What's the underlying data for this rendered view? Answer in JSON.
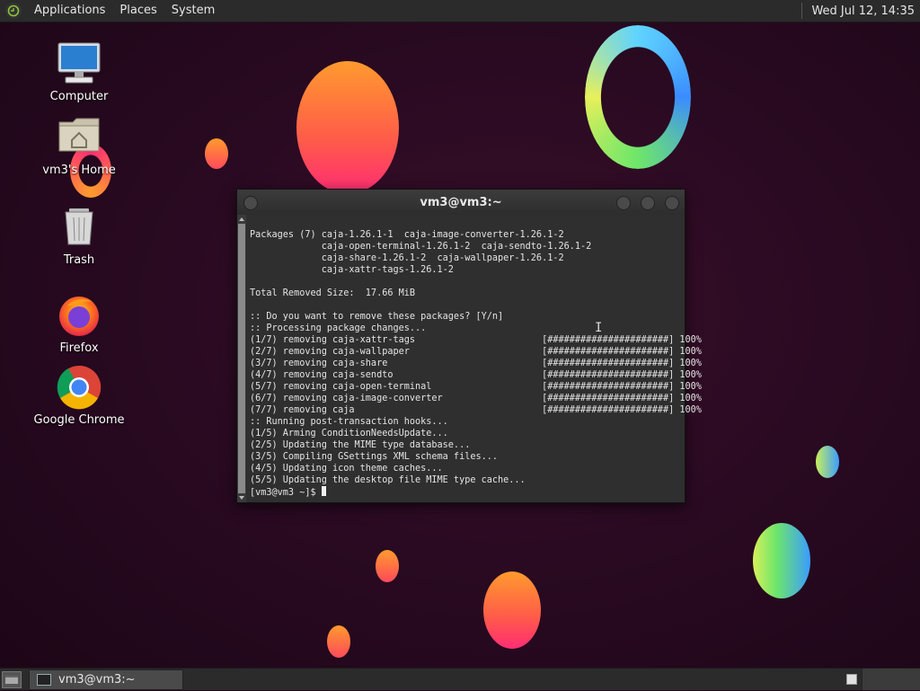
{
  "top_panel": {
    "menus": [
      "Applications",
      "Places",
      "System"
    ],
    "clock": "Wed Jul 12, 14:35"
  },
  "desktop": {
    "icons": [
      {
        "label": "Computer",
        "icon": "computer-icon"
      },
      {
        "label": "vm3's Home",
        "icon": "home-folder-icon"
      },
      {
        "label": "Trash",
        "icon": "trash-icon"
      },
      {
        "label": "Firefox",
        "icon": "firefox-icon"
      },
      {
        "label": "Google Chrome",
        "icon": "chrome-icon"
      }
    ]
  },
  "terminal": {
    "title": "vm3@vm3:~",
    "lines": [
      "Packages (7) caja-1.26.1-1  caja-image-converter-1.26.1-2",
      "             caja-open-terminal-1.26.1-2  caja-sendto-1.26.1-2",
      "             caja-share-1.26.1-2  caja-wallpaper-1.26.1-2",
      "             caja-xattr-tags-1.26.1-2",
      "",
      "Total Removed Size:  17.66 MiB",
      "",
      ":: Do you want to remove these packages? [Y/n]",
      ":: Processing package changes...",
      "(1/7) removing caja-xattr-tags                       [######################] 100%",
      "(2/7) removing caja-wallpaper                        [######################] 100%",
      "(3/7) removing caja-share                            [######################] 100%",
      "(4/7) removing caja-sendto                           [######################] 100%",
      "(5/7) removing caja-open-terminal                    [######################] 100%",
      "(6/7) removing caja-image-converter                  [######################] 100%",
      "(7/7) removing caja                                  [######################] 100%",
      ":: Running post-transaction hooks...",
      "(1/5) Arming ConditionNeedsUpdate...",
      "(2/5) Updating the MIME type database...",
      "(3/5) Compiling GSettings XML schema files...",
      "(4/5) Updating icon theme caches...",
      "(5/5) Updating the desktop file MIME type cache..."
    ],
    "prompt": "[vm3@vm3 ~]$ "
  },
  "bottom_panel": {
    "task_label": "vm3@vm3:~"
  },
  "colors": {
    "background": "#2a0a22",
    "panel": "#2b2b2b",
    "terminal_bg": "#2f2f2f"
  }
}
